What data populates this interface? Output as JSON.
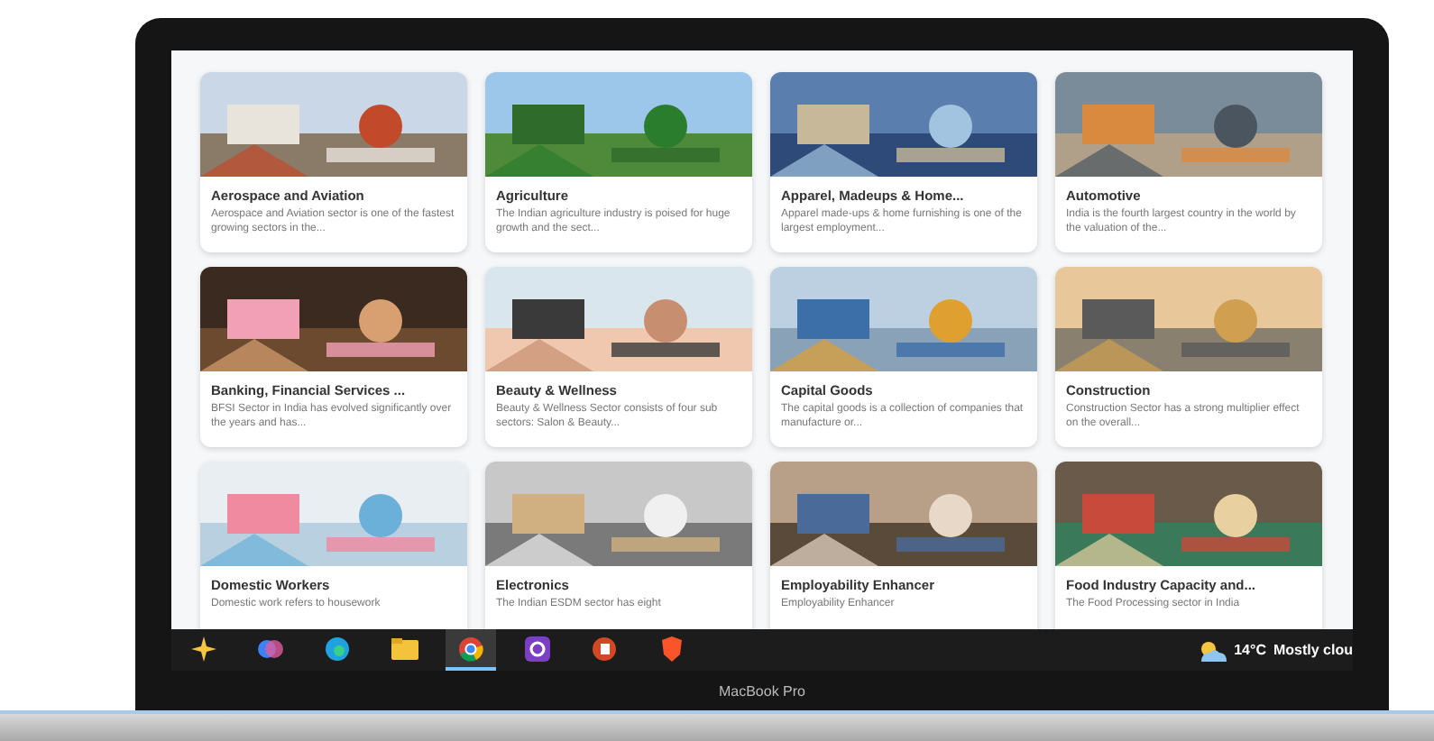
{
  "cards": [
    {
      "kind": "sector",
      "title": "Aerospace and Aviation",
      "description": "Aerospace and Aviation sector is one of the fastest growing sectors in the..."
    },
    {
      "kind": "sector",
      "title": "Agriculture",
      "description": "The Indian agriculture industry is poised for huge growth and the sect..."
    },
    {
      "kind": "sector",
      "title": "Apparel, Madeups & Home...",
      "description": "Apparel made-ups & home furnishing is one of the largest employment..."
    },
    {
      "kind": "sector",
      "title": "Automotive",
      "description": "India is the fourth largest country in the world by the valuation of the..."
    },
    {
      "kind": "sector",
      "title": "Banking, Financial Services ...",
      "description": "BFSI Sector in India has evolved significantly over the years and has..."
    },
    {
      "kind": "sector",
      "title": "Beauty & Wellness",
      "description": "Beauty & Wellness Sector consists of four sub sectors: Salon & Beauty..."
    },
    {
      "kind": "sector",
      "title": "Capital Goods",
      "description": "The capital goods is a collection of companies that manufacture or..."
    },
    {
      "kind": "sector",
      "title": "Construction",
      "description": "Construction Sector has a strong multiplier effect on the overall..."
    },
    {
      "kind": "sector",
      "title": "Domestic Workers",
      "description": "Domestic work refers to housework"
    },
    {
      "kind": "sector",
      "title": "Electronics",
      "description": "The Indian ESDM sector has eight"
    },
    {
      "kind": "sector",
      "title": "Employability Enhancer",
      "description": "Employability Enhancer"
    },
    {
      "kind": "sector",
      "title": "Food Industry Capacity and...",
      "description": "The Food Processing sector in India"
    }
  ],
  "taskbar": {
    "apps": [
      {
        "kind": "sparkle",
        "selected": false
      },
      {
        "kind": "copilot",
        "selected": false
      },
      {
        "kind": "browser",
        "selected": false
      },
      {
        "kind": "folder",
        "selected": false
      },
      {
        "kind": "chrome",
        "selected": true
      },
      {
        "kind": "purple",
        "selected": false
      },
      {
        "kind": "slides",
        "selected": false
      },
      {
        "kind": "shield",
        "selected": false
      }
    ],
    "weather": {
      "temperature": "14°C",
      "condition": "Mostly clou"
    }
  },
  "device_label": "MacBook Pro"
}
